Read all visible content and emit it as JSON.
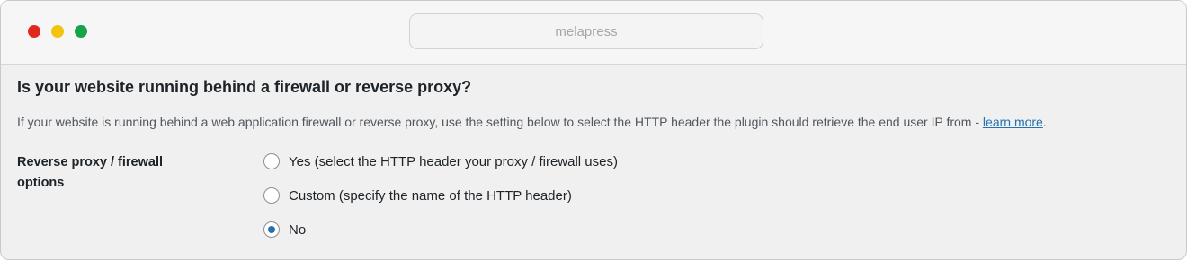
{
  "browser": {
    "url_text": "melapress"
  },
  "section": {
    "heading": "Is your website running behind a firewall or reverse proxy?",
    "description": "If your website is running behind a web application firewall or reverse proxy, use the setting below to select the HTTP header the plugin should retrieve the end user IP from - ",
    "learn_more_link": "learn more",
    "description_end": "."
  },
  "setting": {
    "label_line1": "Reverse proxy / firewall",
    "label_line2": "options",
    "options": [
      {
        "label": "Yes (select the HTTP header your proxy / firewall uses)",
        "checked": false
      },
      {
        "label": "Custom (specify the name of the HTTP header)",
        "checked": false
      },
      {
        "label": "No",
        "checked": true
      }
    ]
  },
  "colors": {
    "accent": "#2271b1",
    "close": "#e0291c",
    "minimize": "#f2c40e",
    "maximize": "#17a34a"
  }
}
